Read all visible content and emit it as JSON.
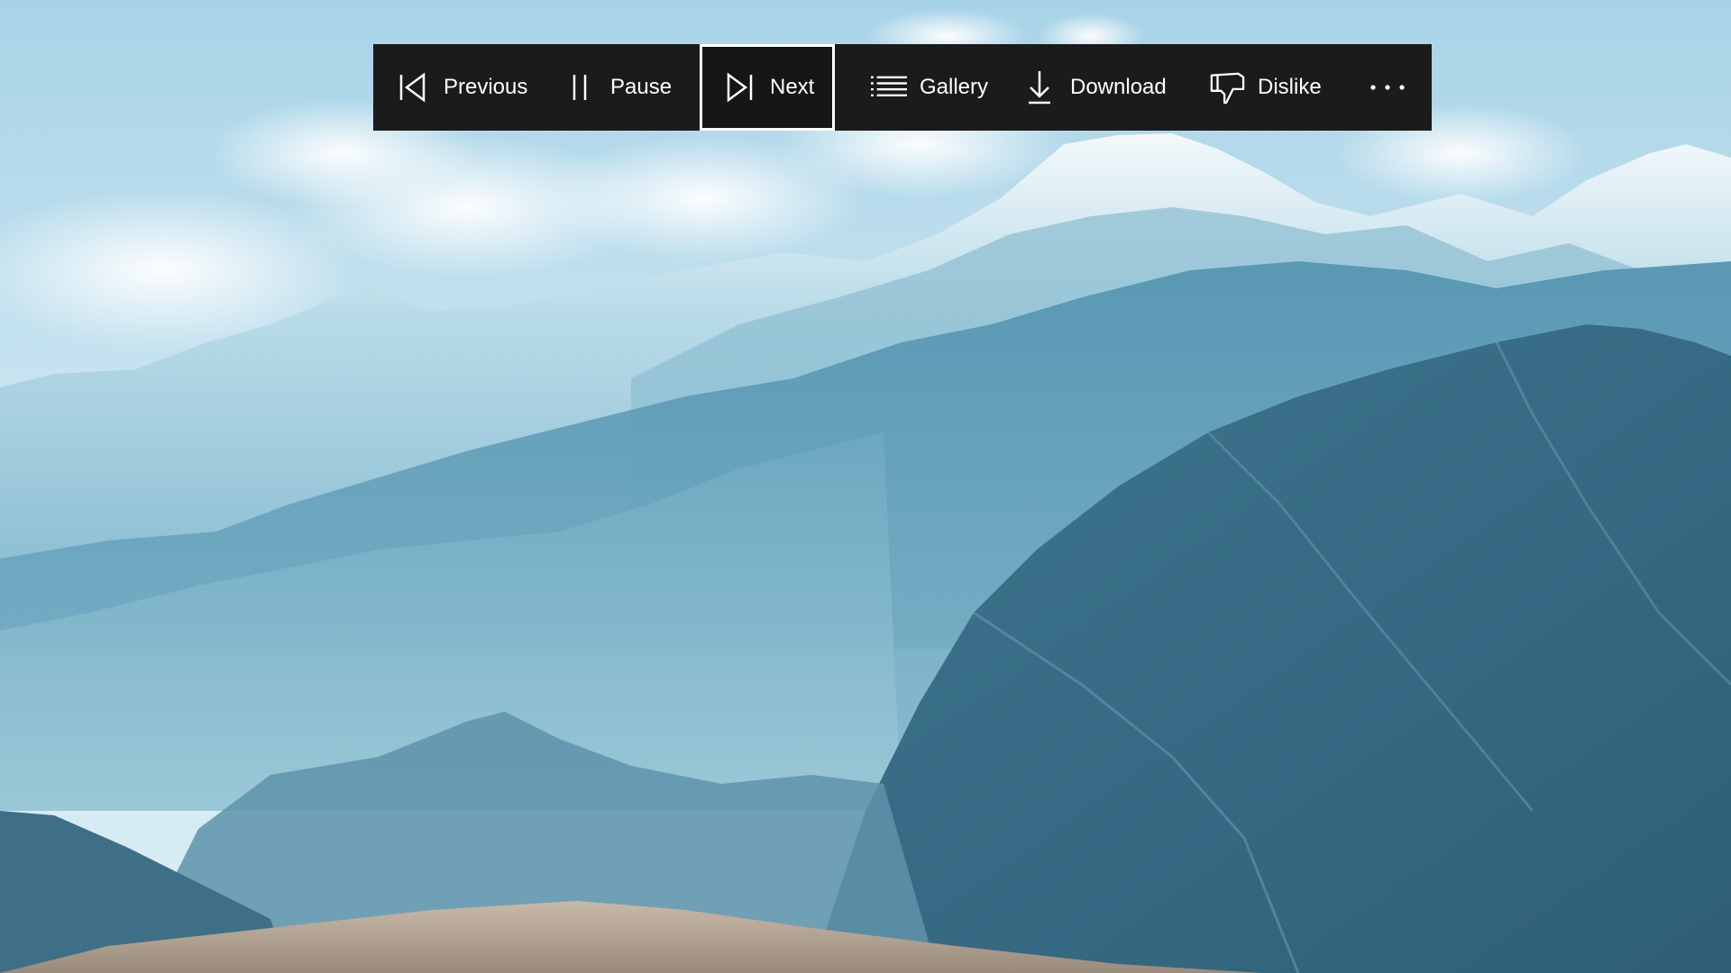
{
  "toolbar": {
    "previous_label": "Previous",
    "pause_label": "Pause",
    "next_label": "Next",
    "gallery_label": "Gallery",
    "download_label": "Download",
    "dislike_label": "Dislike",
    "focused_item": "next"
  },
  "icons": {
    "previous": "skip-previous-icon",
    "pause": "pause-icon",
    "next": "skip-next-icon",
    "gallery": "list-icon",
    "download": "download-icon",
    "dislike": "thumbs-down-icon",
    "more": "more-horizontal-icon"
  },
  "colors": {
    "toolbar_bg": "#1b1b1b",
    "toolbar_text": "#ffffff",
    "focus_outline": "#ffffff"
  }
}
